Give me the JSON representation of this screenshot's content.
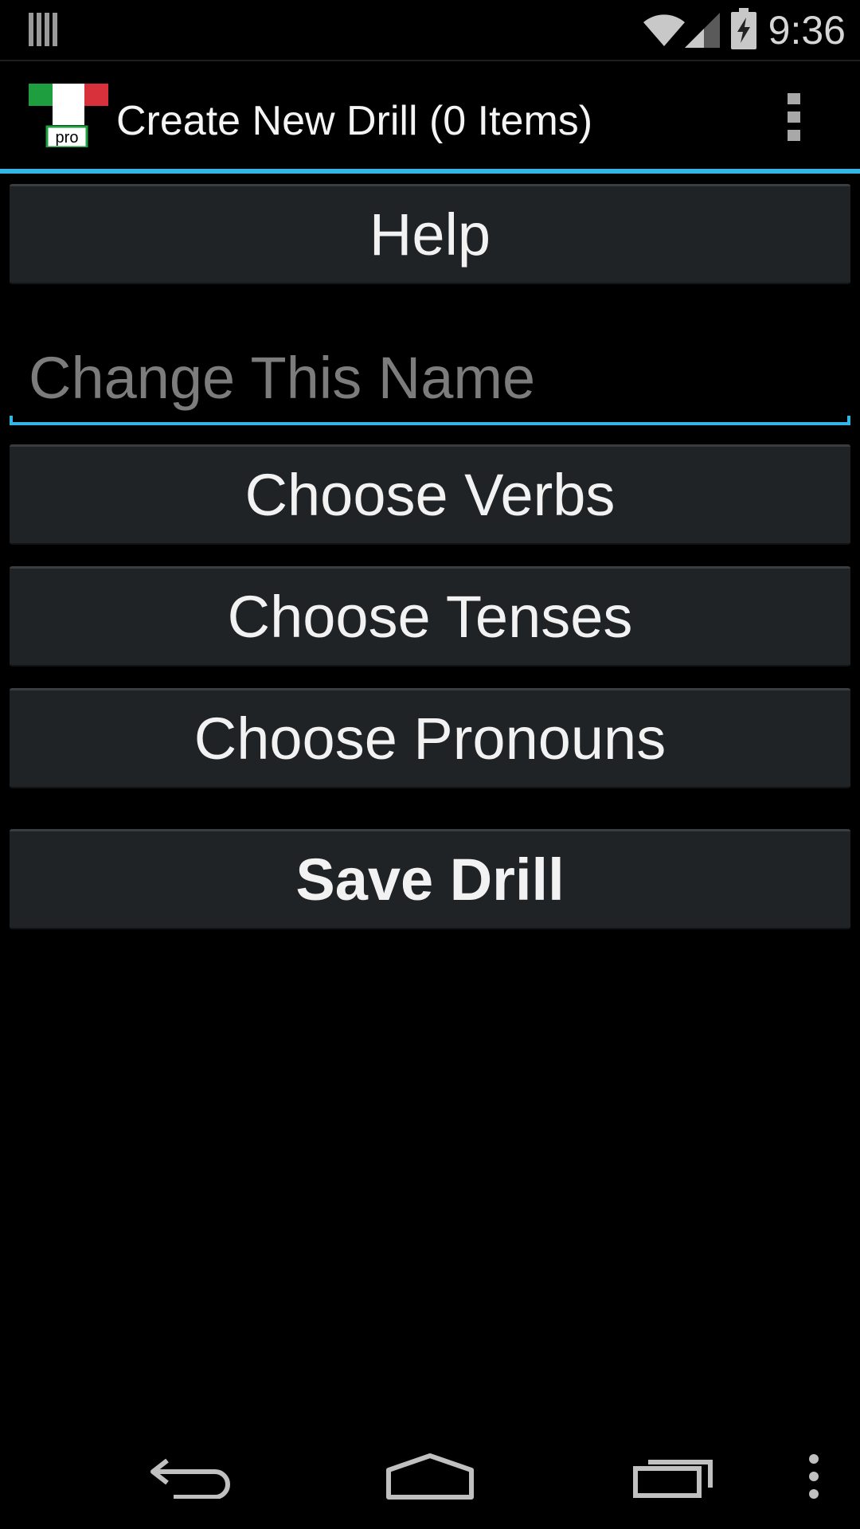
{
  "status_bar": {
    "time": "9:36",
    "icons": [
      "notification-bars-icon",
      "wifi-icon",
      "cell-signal-icon",
      "battery-charging-icon"
    ]
  },
  "action_bar": {
    "title": "Create New Drill (0 Items)",
    "app_icon_badge": "pro",
    "overflow_icon": "overflow-menu-icon"
  },
  "content": {
    "help_label": "Help",
    "name_field": {
      "placeholder": "Change This Name",
      "value": ""
    },
    "choose_verbs_label": "Choose Verbs",
    "choose_tenses_label": "Choose Tenses",
    "choose_pronouns_label": "Choose Pronouns",
    "save_drill_label": "Save Drill"
  },
  "nav_bar": {
    "icons": [
      "back-icon",
      "home-icon",
      "recent-apps-icon",
      "menu-icon"
    ]
  },
  "colors": {
    "accent": "#33b5e5",
    "button_bg": "#202326",
    "flag_green": "#1e9e3e",
    "flag_red": "#d9313c"
  }
}
